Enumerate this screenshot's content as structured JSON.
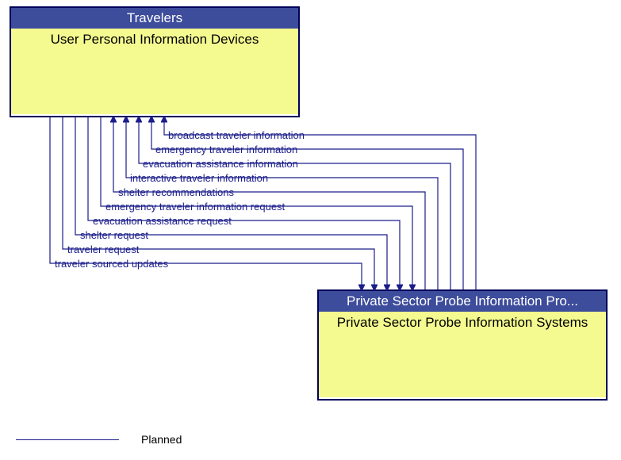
{
  "topBox": {
    "header": "Travelers",
    "body": "User Personal Information Devices"
  },
  "bottomBox": {
    "header": "Private Sector Probe Information Pro...",
    "body": "Private Sector Probe Information Systems"
  },
  "flows": {
    "toTop": [
      "broadcast traveler information",
      "emergency traveler information",
      "evacuation assistance information",
      "interactive traveler information",
      "shelter recommendations"
    ],
    "toBottom": [
      "emergency traveler information request",
      "evacuation assistance request",
      "shelter request",
      "traveler request",
      "traveler sourced updates"
    ]
  },
  "legend": {
    "planned": "Planned"
  }
}
